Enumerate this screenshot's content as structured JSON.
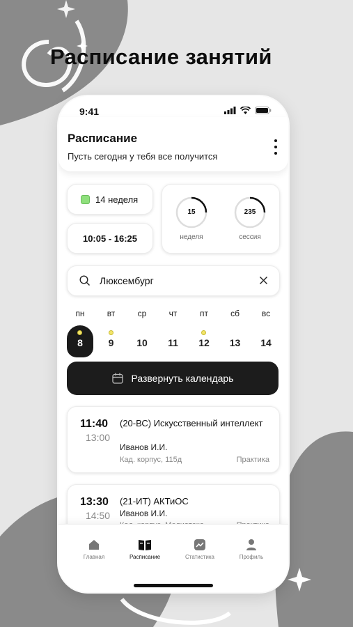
{
  "promo": {
    "title": "Расписание занятий"
  },
  "status_bar": {
    "time": "9:41"
  },
  "header": {
    "title": "Расписание",
    "subtitle": "Пусть сегодня у тебя все получится"
  },
  "info": {
    "week": "14 неделя",
    "time_range": "10:05 - 16:25",
    "stats": [
      {
        "value": "15",
        "label": "неделя"
      },
      {
        "value": "235",
        "label": "сессия"
      }
    ]
  },
  "search": {
    "value": "Люксембург"
  },
  "days": [
    {
      "name": "пн",
      "num": "8",
      "active": true,
      "dot": true
    },
    {
      "name": "вт",
      "num": "9",
      "active": false,
      "dot": true
    },
    {
      "name": "ср",
      "num": "10",
      "active": false,
      "dot": false
    },
    {
      "name": "чт",
      "num": "11",
      "active": false,
      "dot": false
    },
    {
      "name": "пт",
      "num": "12",
      "active": false,
      "dot": true
    },
    {
      "name": "сб",
      "num": "13",
      "active": false,
      "dot": false
    },
    {
      "name": "вс",
      "num": "14",
      "active": false,
      "dot": false
    }
  ],
  "expand_button": {
    "label": "Развернуть календарь"
  },
  "lessons": [
    {
      "start": "11:40",
      "end": "13:00",
      "title": "(20-ВС) Искусственный интеллект",
      "teacher": "Иванов И.И.",
      "room": "Кад. корпус, 115д",
      "type": "Практика"
    },
    {
      "start": "13:30",
      "end": "14:50",
      "title": "(21-ИТ) АКТиОС",
      "teacher": "Иванов И.И.",
      "room": "Кад. корпус, Медиатека",
      "type": "Практика"
    }
  ],
  "tabs": [
    {
      "label": "Главная",
      "icon": "home-icon"
    },
    {
      "label": "Расписание",
      "icon": "book-icon"
    },
    {
      "label": "Статистика",
      "icon": "chart-icon"
    },
    {
      "label": "Профиль",
      "icon": "profile-icon"
    }
  ],
  "colors": {
    "accent": "#1c1c1c",
    "week_indicator": "#8fe07d",
    "day_dot": "#f3e56a"
  }
}
